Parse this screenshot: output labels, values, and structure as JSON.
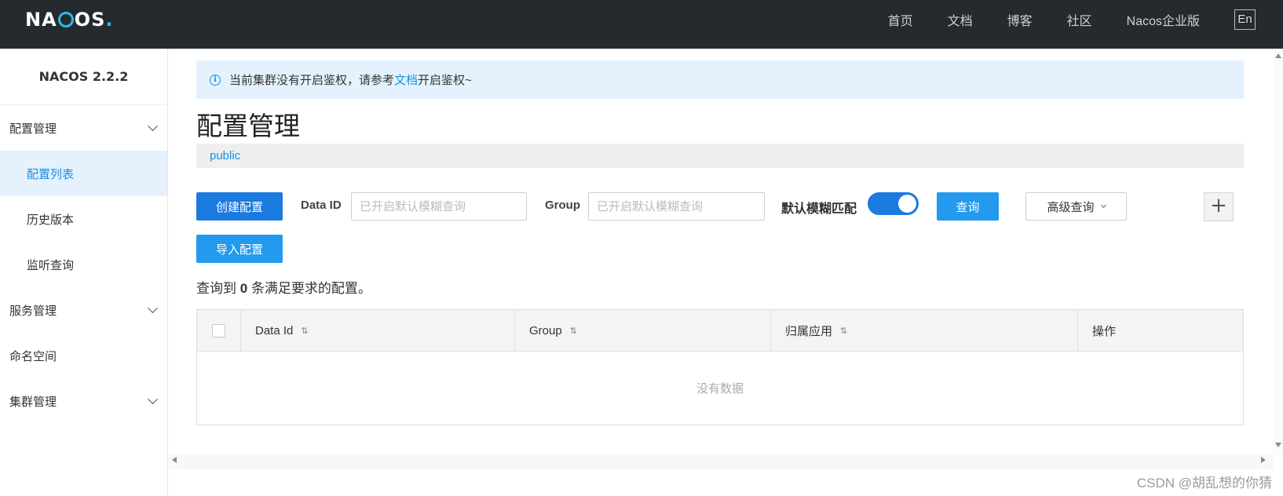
{
  "header": {
    "logo_pre": "NA",
    "logo_post": "OS",
    "logo_dot": ".",
    "nav": [
      "首页",
      "文档",
      "博客",
      "社区",
      "Nacos企业版"
    ],
    "lang": "En"
  },
  "sidebar": {
    "version": "NACOS 2.2.2",
    "items": [
      {
        "label": "配置管理",
        "type": "group"
      },
      {
        "label": "配置列表",
        "type": "sub",
        "active": true
      },
      {
        "label": "历史版本",
        "type": "sub"
      },
      {
        "label": "监听查询",
        "type": "sub"
      },
      {
        "label": "服务管理",
        "type": "group"
      },
      {
        "label": "命名空间",
        "type": "plain"
      },
      {
        "label": "集群管理",
        "type": "group"
      }
    ]
  },
  "notice": {
    "before": "当前集群没有开启鉴权，请参考",
    "link": "文档",
    "after": "开启鉴权~"
  },
  "page": {
    "title": "配置管理",
    "namespace": "public"
  },
  "toolbar": {
    "create_label": "创建配置",
    "data_id_label": "Data ID",
    "data_id_placeholder": "已开启默认模糊查询",
    "group_label": "Group",
    "group_placeholder": "已开启默认模糊查询",
    "fuzzy_label": "默认模糊匹配",
    "fuzzy_on": true,
    "query_label": "查询",
    "advanced_label": "高级查询",
    "plus": "+",
    "import_label": "导入配置"
  },
  "result": {
    "prefix": "查询到",
    "count": "0",
    "suffix": "条满足要求的配置。"
  },
  "table": {
    "columns": [
      "Data Id",
      "Group",
      "归属应用",
      "操作"
    ],
    "empty_text": "没有数据"
  },
  "watermark": "CSDN @胡乱想的你猜",
  "colors": {
    "topbar": "#252a2f",
    "accent": "#1a7ae0",
    "notice_bg": "#e5f2fd"
  }
}
